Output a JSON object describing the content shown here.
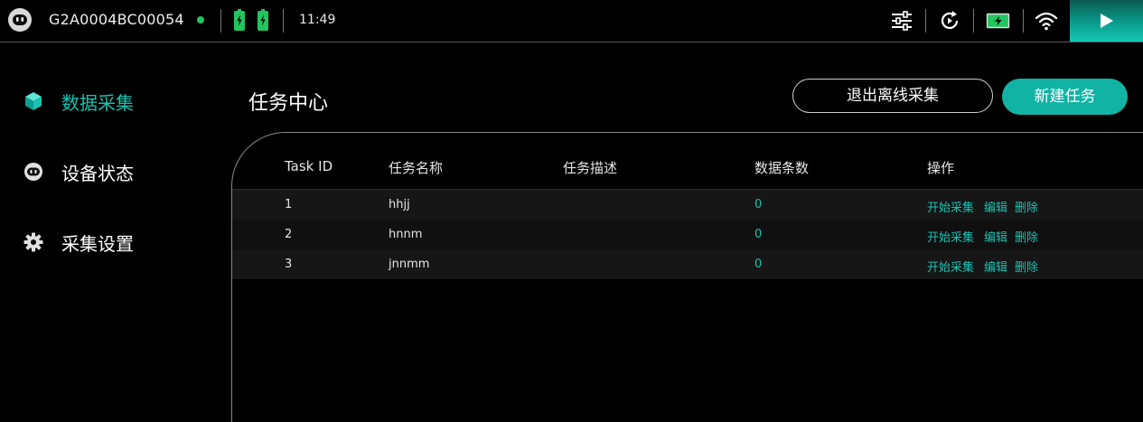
{
  "status_bar": {
    "device_id": "G2A0004BC00054",
    "time": "11:49",
    "colors": {
      "online": "#22c55e",
      "battery": "#22c55e",
      "accent": "#19c2b2"
    }
  },
  "sidebar": {
    "items": [
      {
        "label": "数据采集",
        "icon": "cube-icon",
        "active": true
      },
      {
        "label": "设备状态",
        "icon": "robot-icon",
        "active": false
      },
      {
        "label": "采集设置",
        "icon": "gear-icon",
        "active": false
      }
    ]
  },
  "header": {
    "title": "任务中心",
    "exit_offline_label": "退出离线采集",
    "new_task_label": "新建任务"
  },
  "table": {
    "columns": [
      "Task ID",
      "任务名称",
      "任务描述",
      "数据条数",
      "操作"
    ],
    "rows": [
      {
        "id": "1",
        "name": "hhjj",
        "desc": "",
        "count": "0"
      },
      {
        "id": "2",
        "name": "hnnm",
        "desc": "",
        "count": "0"
      },
      {
        "id": "3",
        "name": "jnnmm",
        "desc": "",
        "count": "0"
      }
    ],
    "actions": {
      "start": "开始采集",
      "edit": "编辑",
      "delete": "删除"
    }
  }
}
